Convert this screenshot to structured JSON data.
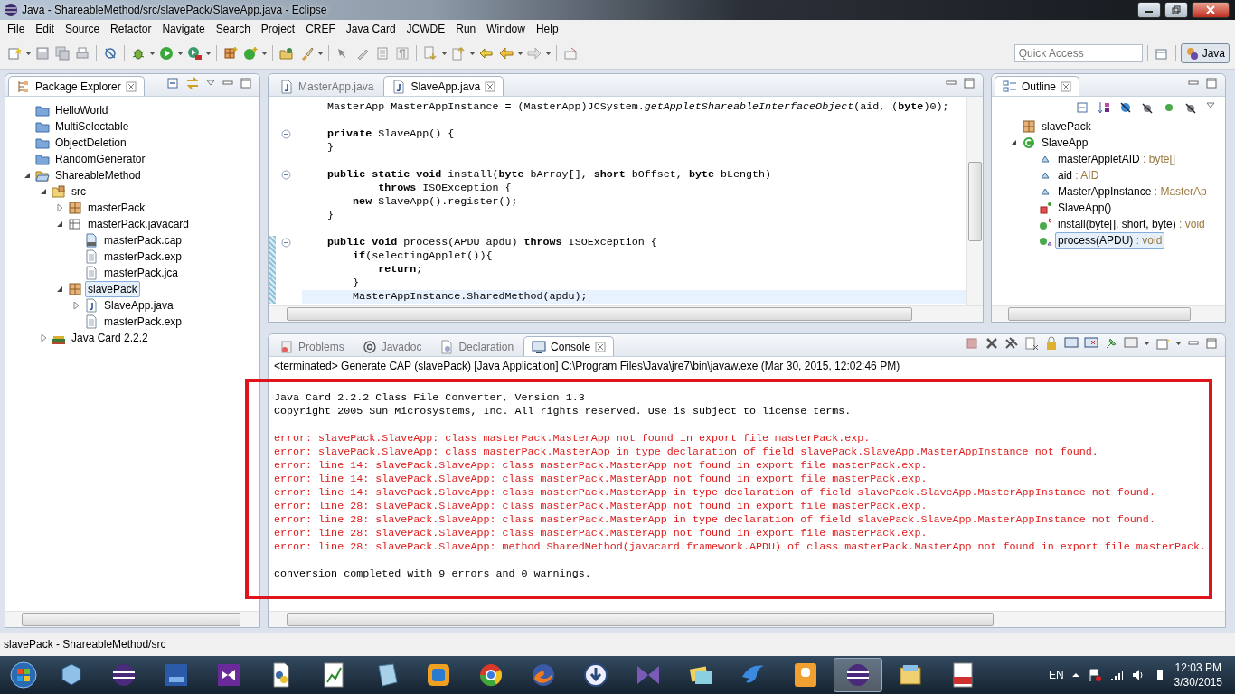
{
  "window": {
    "title": "Java - ShareableMethod/src/slavePack/SlaveApp.java - Eclipse"
  },
  "menu": [
    "File",
    "Edit",
    "Source",
    "Refactor",
    "Navigate",
    "Search",
    "Project",
    "CREF",
    "Java Card",
    "JCWDE",
    "Run",
    "Window",
    "Help"
  ],
  "quick_access": {
    "placeholder": "Quick Access"
  },
  "perspective": {
    "label": "Java",
    "selected": true
  },
  "package_explorer": {
    "tab": {
      "label": "Package Explorer",
      "selected": true
    },
    "tree": [
      {
        "label": "HelloWorld",
        "kind": "project",
        "selected": false
      },
      {
        "label": "MultiSelectable",
        "kind": "project",
        "selected": false
      },
      {
        "label": "ObjectDeletion",
        "kind": "project",
        "selected": false
      },
      {
        "label": "RandomGenerator",
        "kind": "project",
        "selected": false
      },
      {
        "label": "ShareableMethod",
        "kind": "project-open",
        "selected": false,
        "expanded": true,
        "children": [
          {
            "label": "src",
            "kind": "src-folder",
            "selected": false,
            "expanded": true,
            "children": [
              {
                "label": "masterPack",
                "kind": "package",
                "selected": false,
                "expanded": false
              },
              {
                "label": "masterPack.javacard",
                "kind": "javacard-folder",
                "selected": false,
                "expanded": true,
                "children": [
                  {
                    "label": "masterPack.cap",
                    "kind": "cap-file",
                    "selected": false
                  },
                  {
                    "label": "masterPack.exp",
                    "kind": "text-file",
                    "selected": false
                  },
                  {
                    "label": "masterPack.jca",
                    "kind": "text-file",
                    "selected": false
                  }
                ]
              },
              {
                "label": "slavePack",
                "kind": "package",
                "selected": true,
                "expanded": true,
                "children": [
                  {
                    "label": "SlaveApp.java",
                    "kind": "java-file",
                    "selected": false,
                    "expanded": false
                  },
                  {
                    "label": "masterPack.exp",
                    "kind": "text-file",
                    "selected": false
                  }
                ]
              }
            ]
          },
          {
            "label": "Java Card 2.2.2",
            "kind": "library",
            "selected": false,
            "expanded": false
          }
        ]
      }
    ]
  },
  "editor": {
    "tabs": [
      {
        "label": "MasterApp.java",
        "selected": false
      },
      {
        "label": "SlaveApp.java",
        "selected": true
      }
    ],
    "lines": [
      {
        "kind": "code",
        "text": "    MasterApp MasterAppInstance = (MasterApp)JCSystem.*getAppletShareableInterfaceObject*(aid, (**byte**)0);",
        "fold": false,
        "changed": false,
        "current": false
      },
      {
        "kind": "blank"
      },
      {
        "kind": "code",
        "text": "    **private** SlaveApp() {",
        "fold": true,
        "changed": false,
        "current": false
      },
      {
        "kind": "code",
        "text": "    }",
        "fold": false,
        "changed": false,
        "current": false
      },
      {
        "kind": "blank"
      },
      {
        "kind": "code",
        "text": "    **public** **static** **void** install(**byte** bArray[], **short** bOffset, **byte** bLength)",
        "fold": true,
        "changed": false,
        "current": false
      },
      {
        "kind": "code",
        "text": "            **throws** ISOException {",
        "fold": false,
        "changed": false,
        "current": false
      },
      {
        "kind": "code",
        "text": "        **new** SlaveApp().register();",
        "fold": false,
        "changed": false,
        "current": false
      },
      {
        "kind": "code",
        "text": "    }",
        "fold": false,
        "changed": false,
        "current": false
      },
      {
        "kind": "blank"
      },
      {
        "kind": "code",
        "text": "    **public** **void** process(APDU apdu) **throws** ISOException {",
        "fold": true,
        "changed": true,
        "current": false
      },
      {
        "kind": "code",
        "text": "        **if**(selectingApplet()){",
        "fold": false,
        "changed": true,
        "current": false
      },
      {
        "kind": "code",
        "text": "            **return**;",
        "fold": false,
        "changed": true,
        "current": false
      },
      {
        "kind": "code",
        "text": "        }",
        "fold": false,
        "changed": true,
        "current": false
      },
      {
        "kind": "code",
        "text": "        MasterAppInstance.SharedMethod(apdu);",
        "fold": false,
        "changed": true,
        "current": true
      }
    ]
  },
  "outline": {
    "tab": {
      "label": "Outline",
      "selected": true
    },
    "items": [
      {
        "label": "slavePack",
        "kind": "package",
        "selected": false
      },
      {
        "label": "SlaveApp",
        "kind": "class",
        "selected": false,
        "expanded": true,
        "children": [
          {
            "label": "masterAppletAID",
            "type": ": byte[]",
            "kind": "field",
            "selected": false
          },
          {
            "label": "aid",
            "type": ": AID",
            "kind": "field",
            "selected": false
          },
          {
            "label": "MasterAppInstance",
            "type": ": MasterAp",
            "kind": "field",
            "selected": false
          },
          {
            "label": "SlaveApp()",
            "kind": "constructor",
            "selected": false
          },
          {
            "label": "install(byte[], short, byte)",
            "type": ": void",
            "kind": "static-method",
            "selected": false
          },
          {
            "label": "process(APDU)",
            "type": ": void",
            "kind": "method",
            "selected": true
          }
        ]
      }
    ]
  },
  "console": {
    "tabs": [
      {
        "label": "Problems",
        "kind": "problems",
        "selected": false
      },
      {
        "label": "Javadoc",
        "kind": "javadoc",
        "selected": false
      },
      {
        "label": "Declaration",
        "kind": "declaration",
        "selected": false
      },
      {
        "label": "Console",
        "kind": "console",
        "selected": true
      }
    ],
    "process": "<terminated> Generate CAP (slavePack) [Java Application] C:\\Program Files\\Java\\jre7\\bin\\javaw.exe (Mar 30, 2015, 12:02:46 PM)",
    "output": [
      {
        "kind": "info",
        "text": "Java Card 2.2.2 Class File Converter, Version 1.3"
      },
      {
        "kind": "info",
        "text": "Copyright 2005 Sun Microsystems, Inc. All rights reserved. Use is subject to license terms."
      },
      {
        "kind": "blank"
      },
      {
        "kind": "error",
        "text": "error: slavePack.SlaveApp: class masterPack.MasterApp not found in export file masterPack.exp."
      },
      {
        "kind": "error",
        "text": "error: slavePack.SlaveApp: class masterPack.MasterApp in type declaration of field slavePack.SlaveApp.MasterAppInstance not found."
      },
      {
        "kind": "error",
        "text": "error: line 14: slavePack.SlaveApp: class masterPack.MasterApp not found in export file masterPack.exp."
      },
      {
        "kind": "error",
        "text": "error: line 14: slavePack.SlaveApp: class masterPack.MasterApp not found in export file masterPack.exp."
      },
      {
        "kind": "error",
        "text": "error: line 14: slavePack.SlaveApp: class masterPack.MasterApp in type declaration of field slavePack.SlaveApp.MasterAppInstance not found."
      },
      {
        "kind": "error",
        "text": "error: line 28: slavePack.SlaveApp: class masterPack.MasterApp not found in export file masterPack.exp."
      },
      {
        "kind": "error",
        "text": "error: line 28: slavePack.SlaveApp: class masterPack.MasterApp in type declaration of field slavePack.SlaveApp.MasterAppInstance not found."
      },
      {
        "kind": "error",
        "text": "error: line 28: slavePack.SlaveApp: class masterPack.MasterApp not found in export file masterPack.exp."
      },
      {
        "kind": "error",
        "text": "error: line 28: slavePack.SlaveApp: method SharedMethod(javacard.framework.APDU) of class masterPack.MasterApp not found in export file masterPack."
      },
      {
        "kind": "blank"
      },
      {
        "kind": "info",
        "text": "conversion completed with 9 errors and 0 warnings."
      }
    ]
  },
  "status_bar": {
    "text": "slavePack - ShareableMethod/src"
  },
  "taskbar": {
    "language": "EN",
    "time": "12:03 PM",
    "date": "3/30/2015"
  }
}
